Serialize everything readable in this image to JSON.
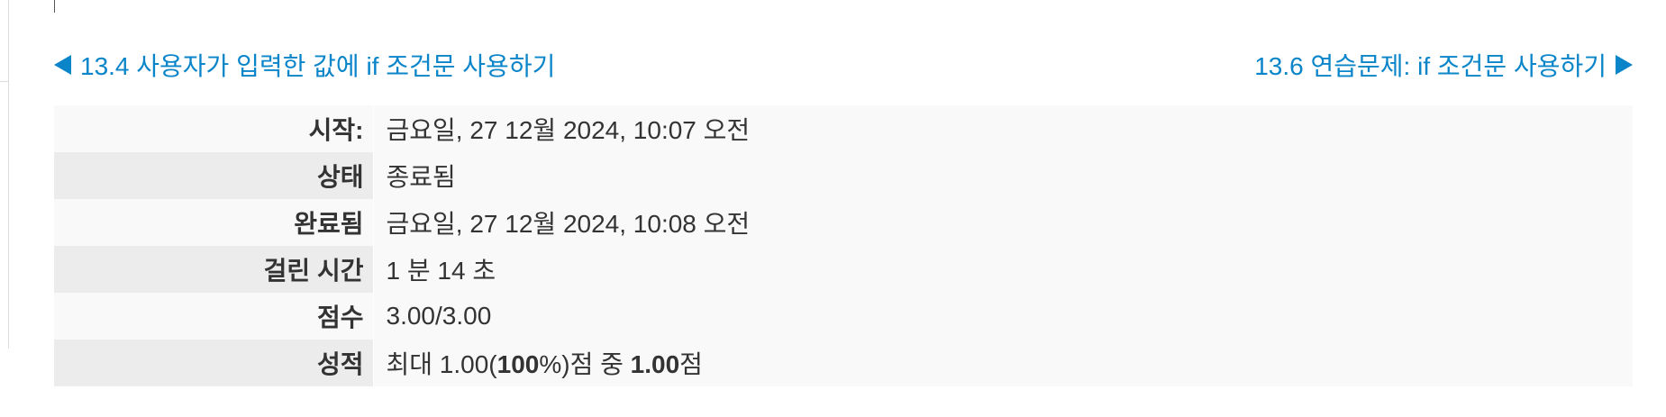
{
  "nav": {
    "prev_label": "13.4 사용자가 입력한 값에 if 조건문 사용하기",
    "next_label": "13.6 연습문제: if 조건문 사용하기"
  },
  "summary": {
    "started": {
      "label": "시작:",
      "value": "금요일, 27 12월 2024, 10:07 오전"
    },
    "state": {
      "label": "상태",
      "value": "종료됨"
    },
    "completed": {
      "label": "완료됨",
      "value": "금요일, 27 12월 2024, 10:08 오전"
    },
    "time_taken": {
      "label": "걸린 시간",
      "value": "1 분 14 초"
    },
    "marks": {
      "label": "점수",
      "value": "3.00/3.00"
    },
    "grade": {
      "label": "성적",
      "prefix": "최대 1.00(",
      "percent": "100",
      "middle": "%)점 중 ",
      "score": "1.00",
      "suffix": "점"
    }
  }
}
